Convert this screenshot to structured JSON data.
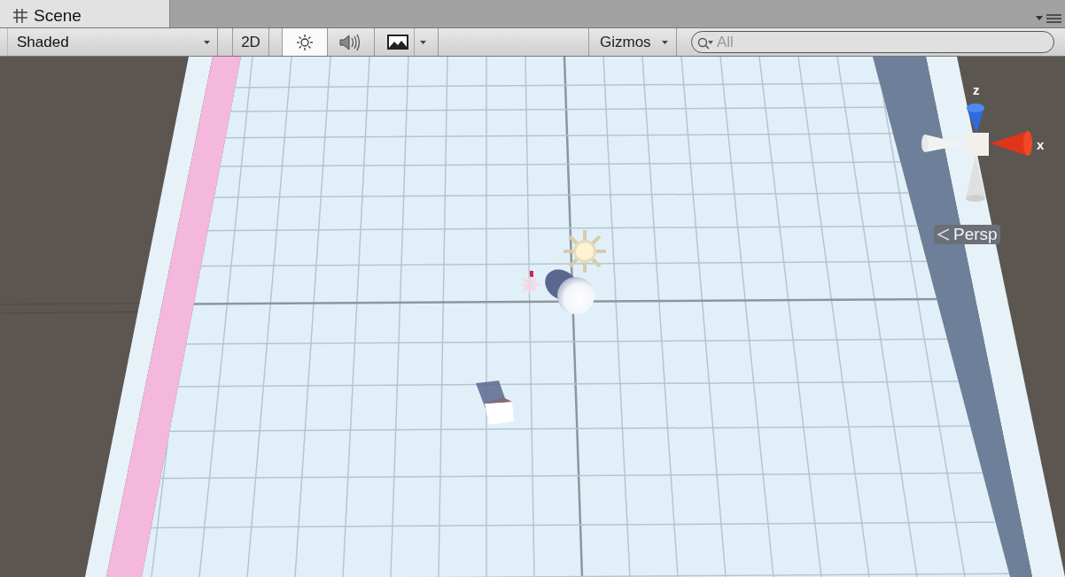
{
  "tabs": [
    {
      "label": "Scene",
      "selected": true
    }
  ],
  "toolbar": {
    "draw_mode": {
      "value": "Shaded"
    },
    "toggles": [
      {
        "kind": "text",
        "label": "2D",
        "selected": false
      },
      {
        "kind": "lighting",
        "selected": true
      },
      {
        "kind": "audio",
        "selected": false
      },
      {
        "kind": "effects",
        "selected": false
      }
    ],
    "gizmos": {
      "label": "Gizmos"
    },
    "search": {
      "placeholder": "All"
    }
  },
  "scene": {
    "gizmo": {
      "y_label": "z",
      "x_label": "x",
      "projection": "Persp"
    }
  }
}
